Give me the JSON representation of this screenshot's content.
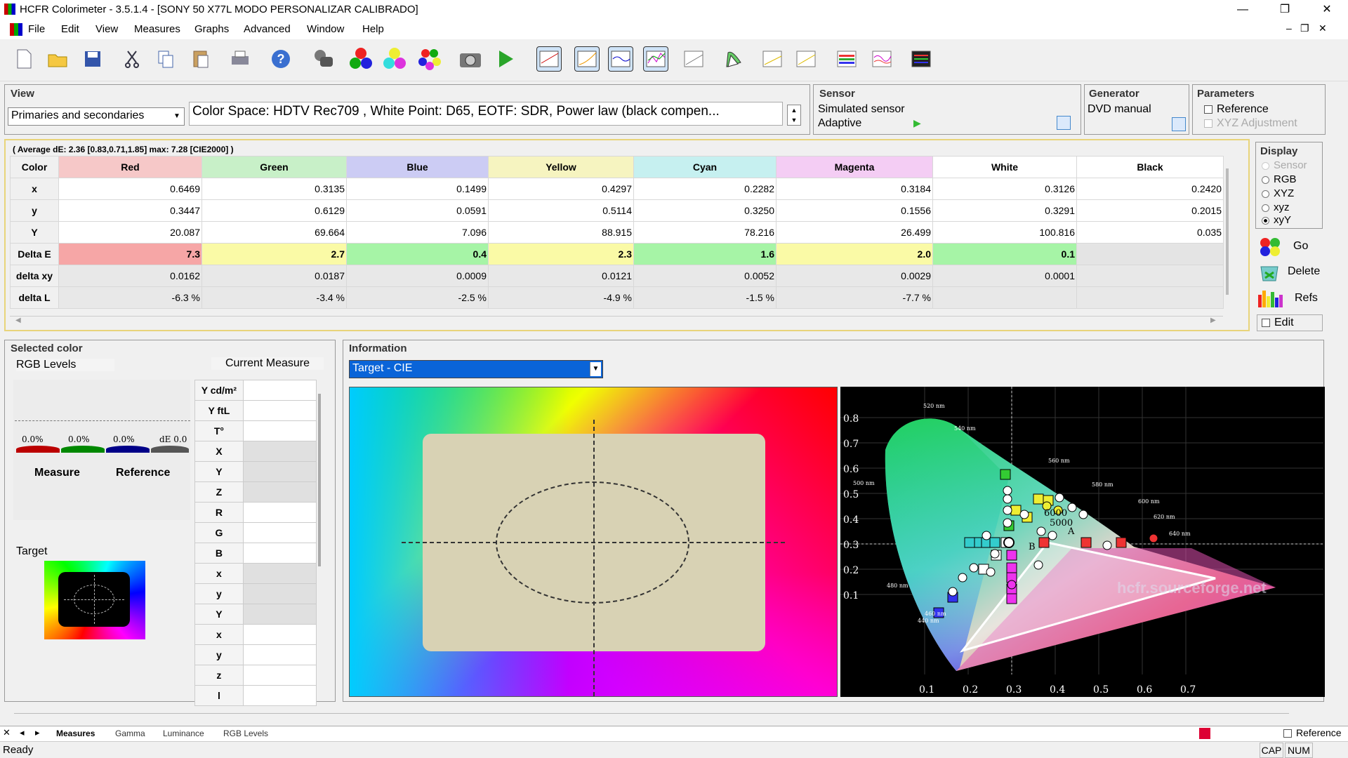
{
  "window": {
    "title": "HCFR Colorimeter - 3.5.1.4 - [SONY 50 X77L MODO PERSONALIZAR CALIBRADO]",
    "min": "—",
    "restore": "❐",
    "close": "✕"
  },
  "menu": [
    "File",
    "Edit",
    "View",
    "Measures",
    "Graphs",
    "Advanced",
    "Window",
    "Help"
  ],
  "mdi": {
    "min": "–",
    "restore": "❐",
    "close": "✕"
  },
  "toolbar_icons": [
    "new-file-icon",
    "open-folder-icon",
    "save-icon",
    "cut-icon",
    "copy-icon",
    "paste-icon",
    "print-icon",
    "help-icon",
    "sensor-icon",
    "primary-colors-icon",
    "secondary-colors-icon",
    "all-colors-icon",
    "camera-icon",
    "play-icon",
    "graph-1-icon",
    "graph-2-icon",
    "graph-3-icon",
    "graph-4-icon",
    "graph-5-icon",
    "cie-graph-icon",
    "graph-7-icon",
    "graph-8-icon",
    "graph-9-icon",
    "graph-10-icon",
    "graph-11-icon"
  ],
  "view": {
    "label": "View",
    "mode": "Primaries and secondaries",
    "colorspace": "Color Space: HDTV Rec709 , White Point: D65, EOTF:  SDR, Power law (black compen..."
  },
  "sensor": {
    "label": "Sensor",
    "name": "Simulated sensor",
    "mode": "Adaptive"
  },
  "generator": {
    "label": "Generator",
    "name": "DVD manual"
  },
  "parameters": {
    "label": "Parameters",
    "reference": "Reference",
    "xyz_adjustment": "XYZ Adjustment"
  },
  "display": {
    "label": "Display",
    "options": [
      "Sensor",
      "RGB",
      "XYZ",
      "xyz",
      "xyY"
    ],
    "selected": "xyY"
  },
  "actions": {
    "go": "Go",
    "delete": "Delete",
    "refs": "Refs",
    "edit": "Edit"
  },
  "summary": "( Average dE: 2.36 [0.83,0.71,1.85] max: 7.28 [CIE2000] )",
  "table": {
    "corner": "Color",
    "columns": [
      "Red",
      "Green",
      "Blue",
      "Yellow",
      "Cyan",
      "Magenta",
      "White",
      "Black"
    ],
    "header_colors": [
      "#f6c8c8",
      "#c8f0c8",
      "#ccccf4",
      "#f6f4c0",
      "#c6f0f0",
      "#f4cdf4",
      "#ffffff",
      "#ffffff"
    ],
    "rows": [
      {
        "label": "x",
        "values": [
          "0.6469",
          "0.3135",
          "0.1499",
          "0.4297",
          "0.2282",
          "0.3184",
          "0.3126",
          "0.2420"
        ]
      },
      {
        "label": "y",
        "values": [
          "0.3447",
          "0.6129",
          "0.0591",
          "0.5114",
          "0.3250",
          "0.1556",
          "0.3291",
          "0.2015"
        ]
      },
      {
        "label": "Y",
        "values": [
          "20.087",
          "69.664",
          "7.096",
          "88.915",
          "78.216",
          "26.499",
          "100.816",
          "0.035"
        ]
      },
      {
        "label": "Delta E",
        "values": [
          "7.3",
          "2.7",
          "0.4",
          "2.3",
          "1.6",
          "2.0",
          "0.1",
          ""
        ],
        "colors": [
          "#f6a6a6",
          "#fafaa6",
          "#a6f4a6",
          "#fafaa6",
          "#a6f4a6",
          "#fafaa6",
          "#a6f4a6",
          "#e4e4e4"
        ]
      },
      {
        "label": "delta xy",
        "values": [
          "0.0162",
          "0.0187",
          "0.0009",
          "0.0121",
          "0.0052",
          "0.0029",
          "0.0001",
          ""
        ]
      },
      {
        "label": "delta L",
        "values": [
          "-6.3 %",
          "-3.4 %",
          "-2.5 %",
          "-4.9 %",
          "-1.5 %",
          "-7.7 %",
          "",
          ""
        ]
      }
    ]
  },
  "selected": {
    "label": "Selected color",
    "rgb_levels": "RGB Levels",
    "current_measure": "Current Measure",
    "level_values": [
      "0.0%",
      "0.0%",
      "0.0%",
      "dE 0.0"
    ],
    "measure": "Measure",
    "reference": "Reference",
    "target": "Target",
    "measure_rows": [
      "Y cd/m²",
      "Y ftL",
      "T°",
      "X",
      "Y",
      "Z",
      "R",
      "G",
      "B",
      "x",
      "y",
      "Y",
      "x",
      "y",
      "z",
      "l"
    ]
  },
  "information": {
    "label": "Information",
    "selector": "Target - CIE",
    "watermark": "hcfr.sourceforge.net",
    "cie_axis_y": [
      "0.8",
      "0.7",
      "0.6",
      "0.5",
      "0.4",
      "0.3",
      "0.2",
      "0.1"
    ],
    "cie_axis_x": [
      "0.1",
      "0.2",
      "0.3",
      "0.4",
      "0.5",
      "0.6",
      "0.7"
    ],
    "nm_labels": [
      "520 nm",
      "540 nm",
      "560 nm",
      "580 nm",
      "600 nm",
      "620 nm",
      "640 nm",
      "500 nm",
      "480 nm",
      "460 nm",
      "440 nm"
    ],
    "letters": [
      "A",
      "B",
      "5000",
      "6000"
    ]
  },
  "tabs": [
    "Measures",
    "Gamma",
    "Luminance",
    "RGB Levels"
  ],
  "status": {
    "text": "Ready",
    "reference": "Reference",
    "cap": "CAP",
    "num": "NUM"
  }
}
